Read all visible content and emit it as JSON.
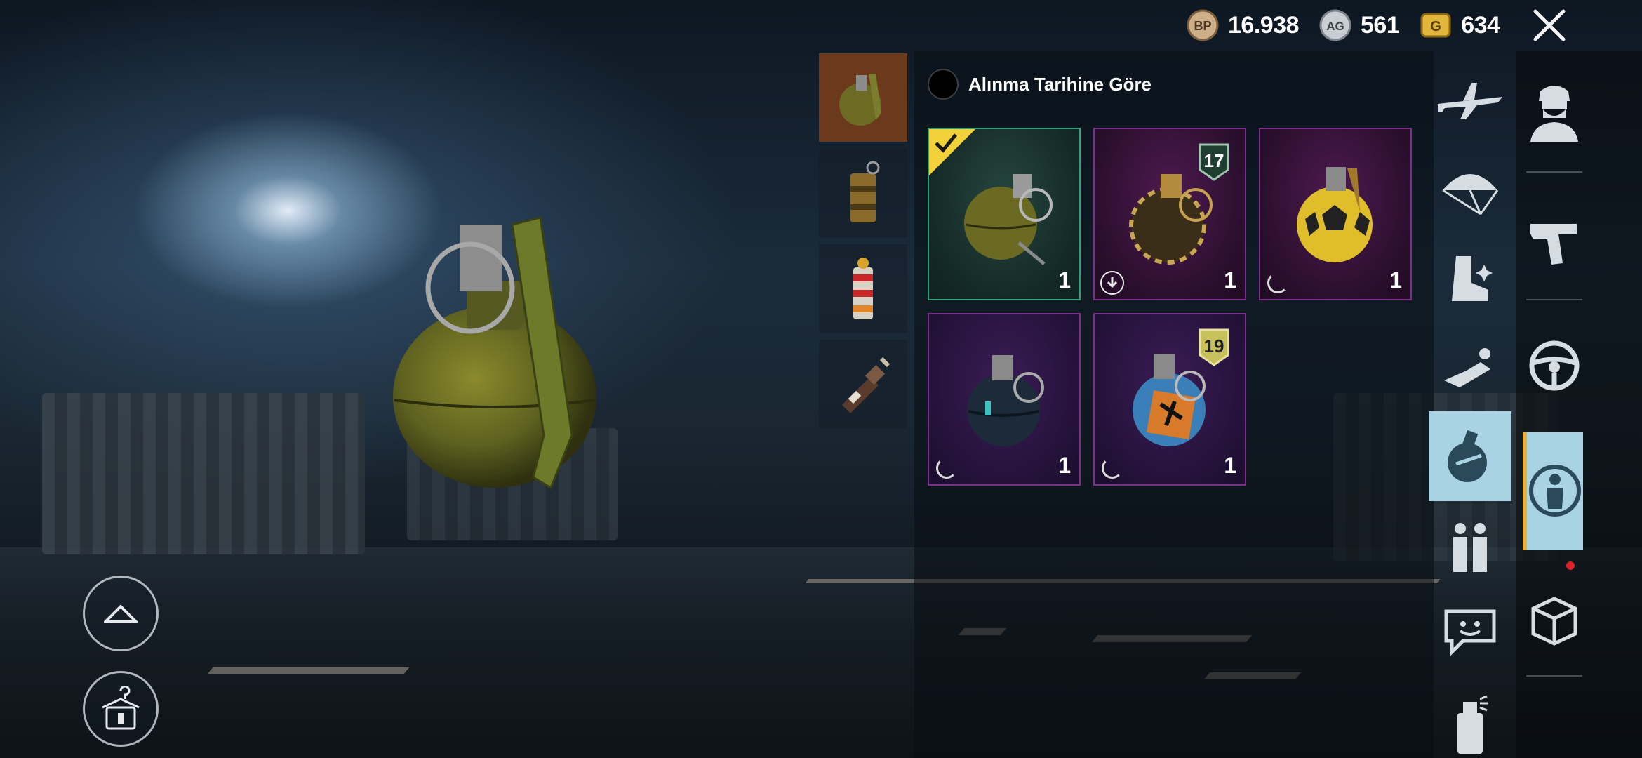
{
  "currency": {
    "bp": {
      "icon": "bp-coin-icon",
      "icon_text": "BP",
      "value": "16.938"
    },
    "ag": {
      "icon": "ag-coin-icon",
      "icon_text": "AG",
      "value": "561"
    },
    "g": {
      "icon": "g-coin-icon",
      "icon_text": "G",
      "value": "634"
    }
  },
  "sort": {
    "label": "Alınma Tarihine Göre"
  },
  "subcategories": [
    {
      "name": "frag-grenade",
      "active": true
    },
    {
      "name": "smoke-grenade",
      "active": false
    },
    {
      "name": "stun-grenade",
      "active": false
    },
    {
      "name": "molotov",
      "active": false
    }
  ],
  "items": [
    {
      "quantity": "1",
      "selected": true,
      "badge": "",
      "status": "equipped"
    },
    {
      "quantity": "1",
      "selected": false,
      "badge": "17",
      "status": "download"
    },
    {
      "quantity": "1",
      "selected": false,
      "badge": "",
      "status": "loading"
    },
    {
      "quantity": "1",
      "selected": false,
      "badge": "",
      "status": "loading"
    },
    {
      "quantity": "1",
      "selected": false,
      "badge": "19",
      "status": "loading"
    }
  ],
  "categories": [
    "airplane-icon",
    "parachute-icon",
    "shoes-icon",
    "emote-icon",
    "grenade-icon",
    "companion-icon",
    "chat-icon",
    "spray-icon"
  ],
  "tabs": [
    "outfit-icon",
    "weapon-icon",
    "vehicle-icon",
    "items-icon",
    "crate-icon"
  ],
  "colors": {
    "accent": "#a9d3e2",
    "selected_border": "#2fa07a",
    "epic_border": "#7b2f8c",
    "subcat_active": "#6b3a1c"
  }
}
